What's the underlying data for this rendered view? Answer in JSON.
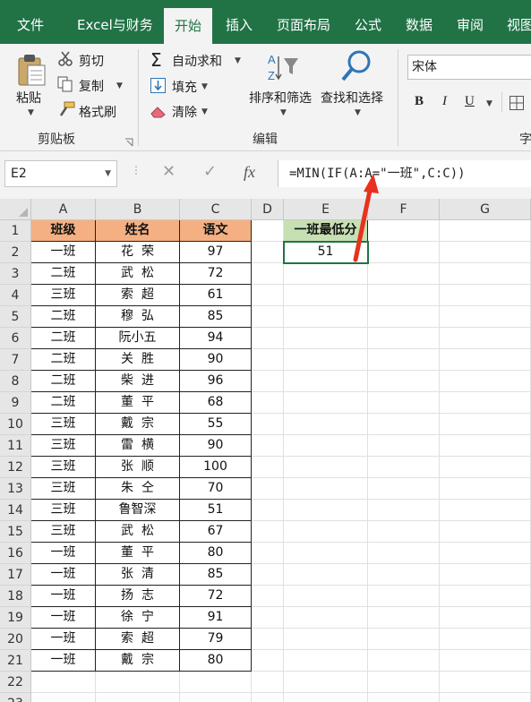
{
  "tabs": [
    "文件",
    "Excel与财务",
    "开始",
    "插入",
    "页面布局",
    "公式",
    "数据",
    "审阅",
    "视图"
  ],
  "active_tab": "开始",
  "ribbon": {
    "paste_label": "粘贴",
    "cut_label": "剪切",
    "copy_label": "复制",
    "format_painter_label": "格式刷",
    "clipboard_group": "剪贴板",
    "autosum_label": "自动求和",
    "fill_label": "填充",
    "clear_label": "清除",
    "sort_filter_label": "排序和筛选",
    "find_select_label": "查找和选择",
    "edit_group": "编辑",
    "font_name": "宋体",
    "bold_label": "B",
    "italic_label": "I",
    "underline_label": "U",
    "font_group_partial": "字"
  },
  "formula_bar": {
    "name_box": "E2",
    "formula": "=MIN(IF(A:A=\"一班\",C:C))",
    "fx_label": "fx"
  },
  "colors": {
    "excel_green": "#217346",
    "header_orange": "#f4b083",
    "header_green": "#c6e0b4",
    "arrow_red": "#e8311f"
  },
  "columns": [
    "A",
    "B",
    "C",
    "D",
    "E",
    "F",
    "G"
  ],
  "rows": [
    "1",
    "2",
    "3",
    "4",
    "5",
    "6",
    "7",
    "8",
    "9",
    "10",
    "11",
    "12",
    "13",
    "14",
    "15",
    "16",
    "17",
    "18",
    "19",
    "20",
    "21",
    "22",
    "23"
  ],
  "table": {
    "headers": [
      "班级",
      "姓名",
      "语文"
    ],
    "data": [
      [
        "一班",
        "花  荣",
        "97"
      ],
      [
        "二班",
        "武  松",
        "72"
      ],
      [
        "三班",
        "索  超",
        "61"
      ],
      [
        "二班",
        "穆  弘",
        "85"
      ],
      [
        "二班",
        "阮小五",
        "94"
      ],
      [
        "二班",
        "关  胜",
        "90"
      ],
      [
        "二班",
        "柴  进",
        "96"
      ],
      [
        "二班",
        "董  平",
        "68"
      ],
      [
        "三班",
        "戴  宗",
        "55"
      ],
      [
        "三班",
        "雷  横",
        "90"
      ],
      [
        "三班",
        "张  顺",
        "100"
      ],
      [
        "三班",
        "朱  仝",
        "70"
      ],
      [
        "三班",
        "鲁智深",
        "51"
      ],
      [
        "三班",
        "武  松",
        "67"
      ],
      [
        "一班",
        "董  平",
        "80"
      ],
      [
        "一班",
        "张  清",
        "85"
      ],
      [
        "一班",
        "扬  志",
        "72"
      ],
      [
        "一班",
        "徐  宁",
        "91"
      ],
      [
        "一班",
        "索  超",
        "79"
      ],
      [
        "一班",
        "戴  宗",
        "80"
      ]
    ]
  },
  "result": {
    "header": "一班最低分",
    "value": "51"
  }
}
